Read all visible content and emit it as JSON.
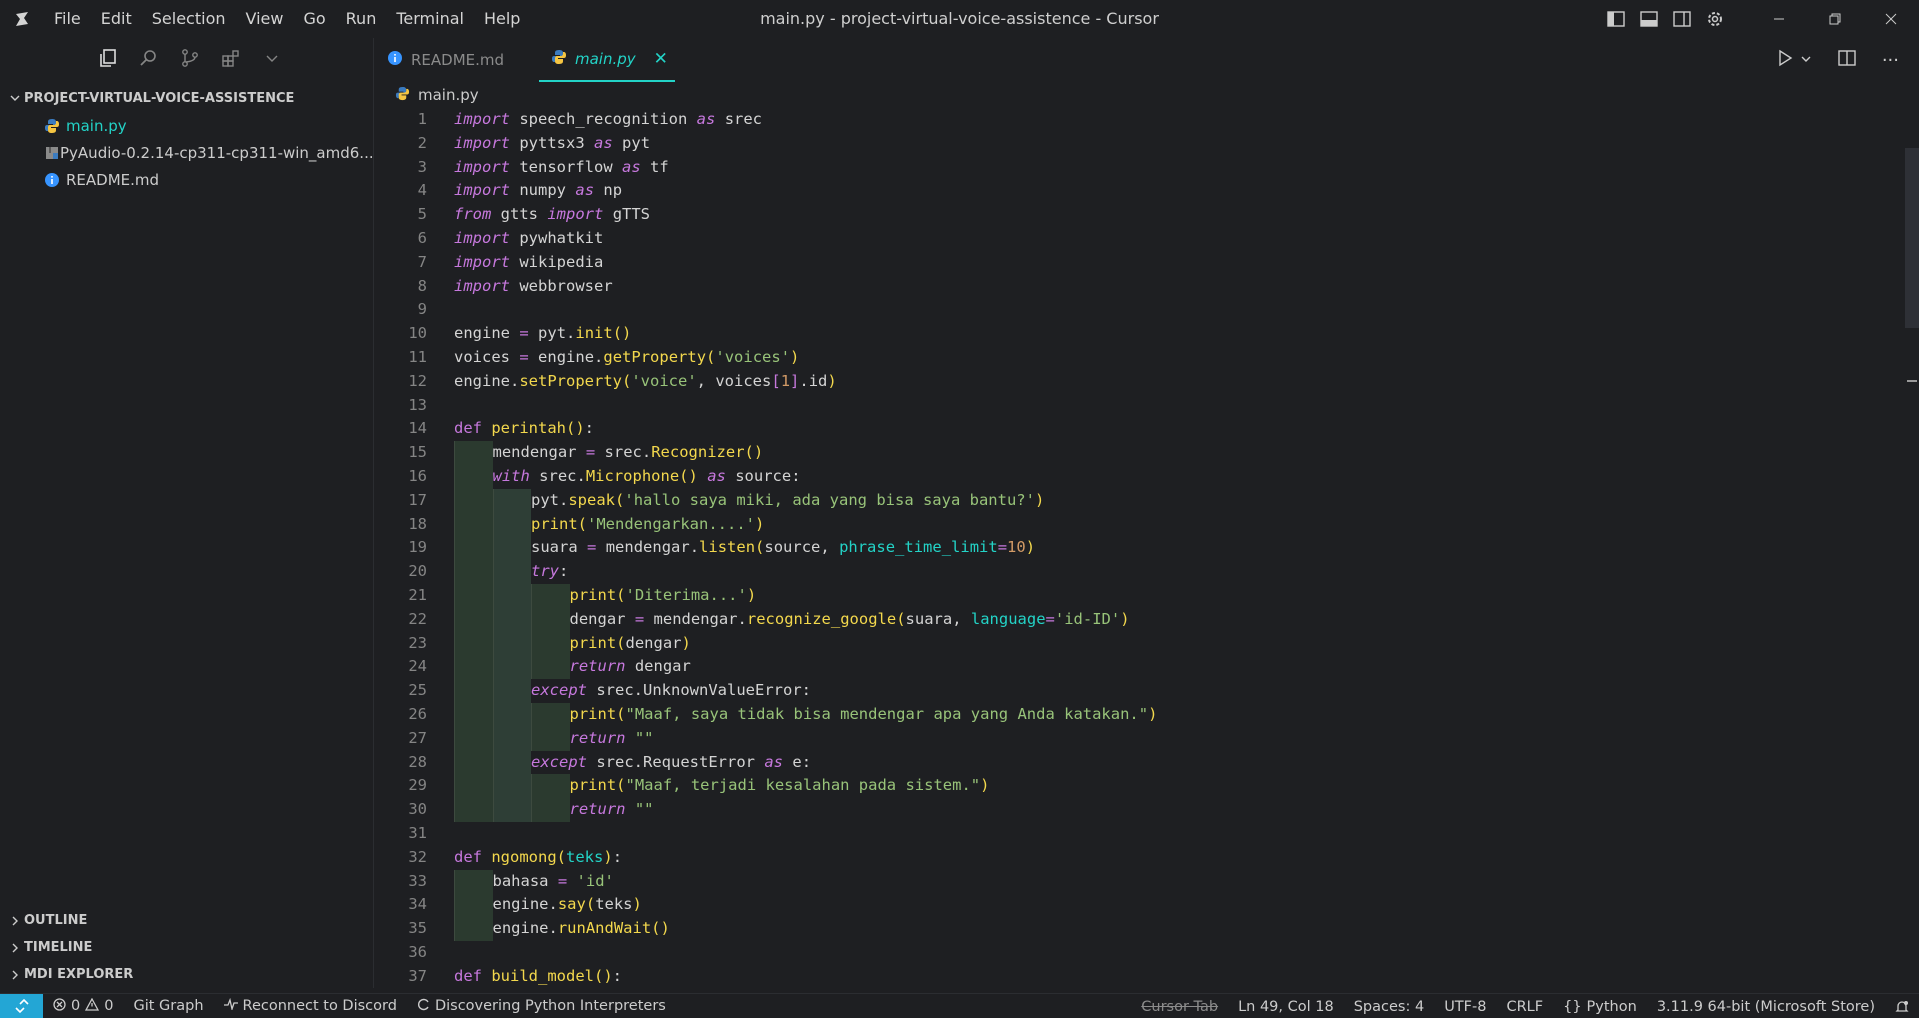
{
  "window": {
    "title": "main.py - project-virtual-voice-assistence - Cursor",
    "menu": [
      "File",
      "Edit",
      "Selection",
      "View",
      "Go",
      "Run",
      "Terminal",
      "Help"
    ]
  },
  "sidebar": {
    "root": "PROJECT-VIRTUAL-VOICE-ASSISTENCE",
    "files": [
      {
        "name": "main.py",
        "icon": "python-file-icon",
        "active": true
      },
      {
        "name": "PyAudio-0.2.14-cp311-cp311-win_amd6...",
        "icon": "package-file-icon",
        "active": false
      },
      {
        "name": "README.md",
        "icon": "info-file-icon",
        "active": false
      }
    ],
    "sections": [
      "OUTLINE",
      "TIMELINE",
      "MDI EXPLORER"
    ]
  },
  "editor": {
    "tabs": [
      {
        "label": "README.md",
        "icon": "info-file-icon",
        "active": false
      },
      {
        "label": "main.py",
        "icon": "python-file-icon",
        "active": true
      }
    ],
    "breadcrumb": "main.py",
    "line_numbers": [
      "1",
      "2",
      "3",
      "4",
      "5",
      "6",
      "7",
      "8",
      "9",
      "10",
      "11",
      "12",
      "13",
      "14",
      "15",
      "16",
      "17",
      "18",
      "19",
      "20",
      "21",
      "22",
      "23",
      "24",
      "25",
      "26",
      "27",
      "28",
      "29",
      "30",
      "31",
      "32",
      "33",
      "34",
      "35",
      "36",
      "37"
    ]
  },
  "code": {
    "kw_import": "import",
    "kw_as": "as",
    "kw_from": "from",
    "kw_def": "def",
    "kw_with": "with",
    "kw_try": "try",
    "kw_except": "except",
    "kw_return": "return",
    "mod_speech": "speech_recognition",
    "srec": "srec",
    "pyttsx3": "pyttsx3",
    "pyt": "pyt",
    "tensorflow": "tensorflow",
    "tf": "tf",
    "numpy": "numpy",
    "np": "np",
    "gtts": "gtts",
    "gTTS": "gTTS",
    "pywhatkit": "pywhatkit",
    "wikipedia": "wikipedia",
    "webbrowser": "webbrowser",
    "engine": "engine",
    "init": "init",
    "voices": "voices",
    "getProperty": "getProperty",
    "str_voices": "'voices'",
    "setProperty": "setProperty",
    "str_voice": "'voice'",
    "one": "1",
    "id": "id",
    "perintah": "perintah",
    "mendengar": "mendengar",
    "Recognizer": "Recognizer",
    "Microphone": "Microphone",
    "source": "source",
    "speak": "speak",
    "str_hallo": "'hallo saya miki, ada yang bisa saya bantu?'",
    "print": "print",
    "str_mendengarkan": "'Mendengarkan....'",
    "suara": "suara",
    "listen": "listen",
    "phrase_time_limit": "phrase_time_limit",
    "ten": "10",
    "str_diterima": "'Diterima...'",
    "dengar": "dengar",
    "recognize_google": "recognize_google",
    "language": "language",
    "str_id": "'id-ID'",
    "UnknownValueError": "UnknownValueError",
    "str_maaf1": "\"Maaf, saya tidak bisa mendengar apa yang Anda katakan.\"",
    "empty": "\"\"",
    "RequestError": "RequestError",
    "e": "e",
    "str_maaf2": "\"Maaf, terjadi kesalahan pada sistem.\"",
    "ngomong": "ngomong",
    "teks": "teks",
    "bahasa": "bahasa",
    "str_id2": "'id'",
    "say": "say",
    "runAndWait": "runAndWait",
    "build_model": "build_model"
  },
  "statusbar": {
    "errors": "0",
    "warnings": "0",
    "git": "Git Graph",
    "discord": "Reconnect to Discord",
    "discovering": "Discovering Python Interpreters",
    "cursor_tab": "Cursor Tab",
    "position": "Ln 49, Col 18",
    "spaces": "Spaces: 4",
    "encoding": "UTF-8",
    "eol": "CRLF",
    "language": "Python",
    "interpreter": "3.11.9 64-bit (Microsoft Store)"
  },
  "colors": {
    "accent": "#23d3c7",
    "keyword": "#c678dd",
    "function": "#f3d84d",
    "string": "#98c379",
    "number": "#d19a66",
    "remote": "#23a6d5"
  }
}
